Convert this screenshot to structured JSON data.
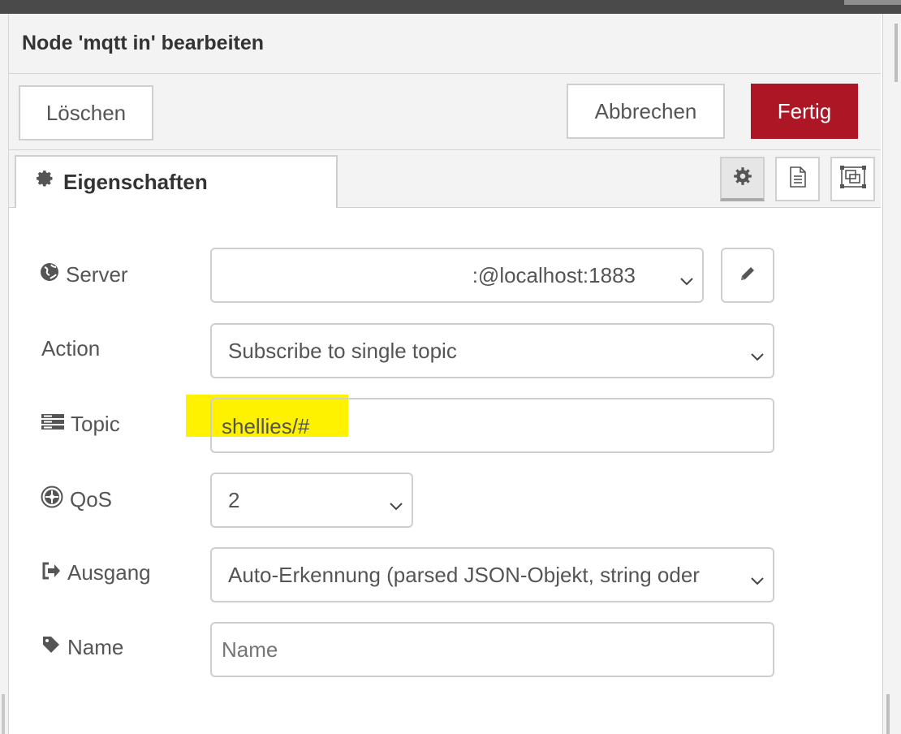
{
  "dialog": {
    "title": "Node 'mqtt in' bearbeiten",
    "buttons": {
      "delete": "Löschen",
      "cancel": "Abbrechen",
      "done": "Fertig"
    },
    "tab": {
      "label": "Eigenschaften",
      "icon": "gear-icon"
    },
    "tab_icons": [
      "gear-icon",
      "document-icon",
      "frame-icon"
    ],
    "accent_color": "#ad1625"
  },
  "form": {
    "server": {
      "label": "Server",
      "icon": "globe-icon",
      "value": ":@localhost:1883"
    },
    "action": {
      "label": "Action",
      "value": "Subscribe to single topic"
    },
    "topic": {
      "label": "Topic",
      "icon": "list-icon",
      "value": "shellies/#",
      "highlight_color": "#fff200"
    },
    "qos": {
      "label": "QoS",
      "icon": "qos-icon",
      "value": "2"
    },
    "output": {
      "label": "Ausgang",
      "icon": "sign-out-icon",
      "value": "Auto-Erkennung (parsed JSON-Objekt, string oder"
    },
    "name": {
      "label": "Name",
      "icon": "tag-icon",
      "value": "",
      "placeholder": "Name"
    }
  }
}
